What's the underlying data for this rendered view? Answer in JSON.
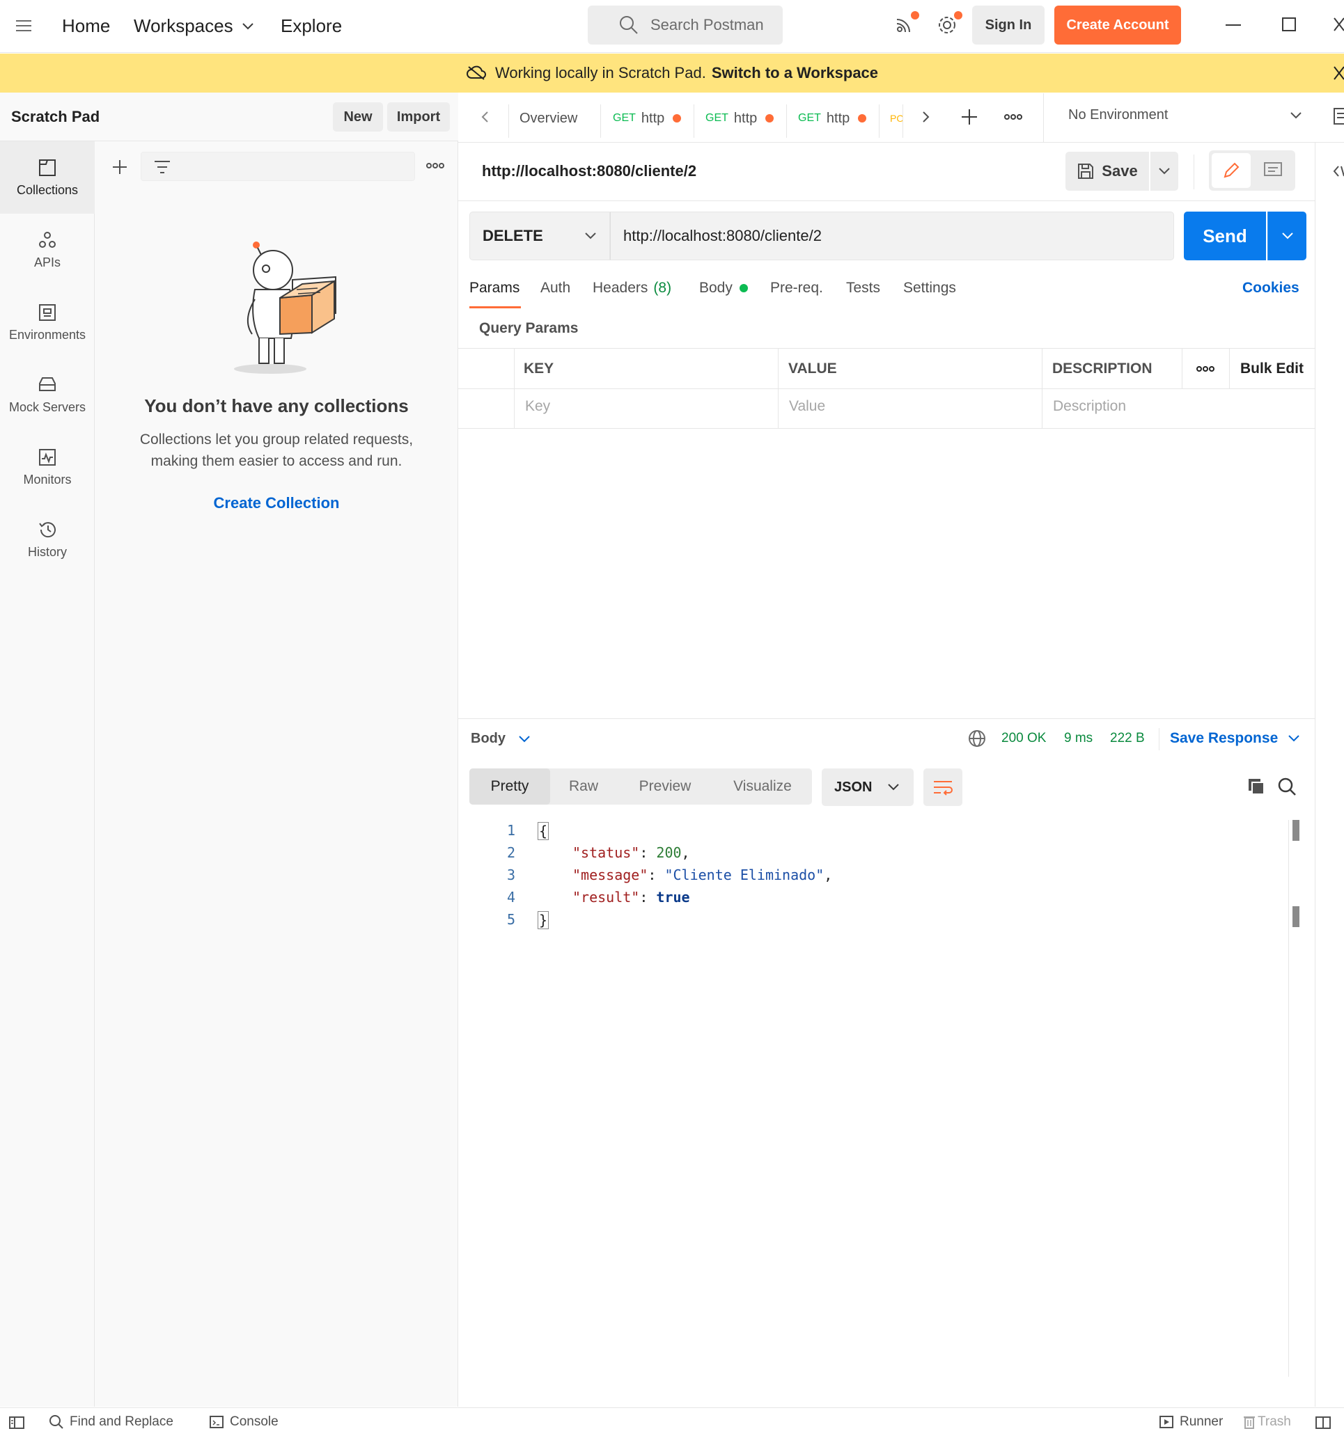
{
  "topbar": {
    "nav": [
      {
        "label": "Home"
      },
      {
        "label": "Workspaces"
      },
      {
        "label": "Explore"
      }
    ],
    "search_placeholder": "Search Postman",
    "sign_in": "Sign In",
    "create_account": "Create Account"
  },
  "banner": {
    "text": "Working locally in Scratch Pad.",
    "link": "Switch to a Workspace"
  },
  "rail": {
    "items": [
      {
        "label": "Collections",
        "icon": "collections-icon"
      },
      {
        "label": "APIs",
        "icon": "apis-icon"
      },
      {
        "label": "Environments",
        "icon": "environments-icon"
      },
      {
        "label": "Mock Servers",
        "icon": "mock-servers-icon"
      },
      {
        "label": "Monitors",
        "icon": "monitors-icon"
      },
      {
        "label": "History",
        "icon": "history-icon"
      }
    ]
  },
  "sidebar": {
    "title": "Scratch Pad",
    "new_label": "New",
    "import_label": "Import",
    "empty_title": "You don’t have any collections",
    "empty_desc": "Collections let you group related requests, making them easier to access and run.",
    "create_collection": "Create Collection"
  },
  "tabs": {
    "overview": "Overview",
    "items": [
      {
        "method": "GET",
        "label": "http"
      },
      {
        "method": "GET",
        "label": "http"
      },
      {
        "method": "GET",
        "label": "http"
      }
    ],
    "partial": "PO",
    "environment": "No Environment"
  },
  "request": {
    "title": "http://localhost:8080/cliente/2",
    "save_label": "Save",
    "method": "DELETE",
    "url": "http://localhost:8080/cliente/2",
    "send_label": "Send",
    "tabs": {
      "params": "Params",
      "auth": "Auth",
      "headers": "Headers",
      "headers_count": "(8)",
      "body": "Body",
      "prereq": "Pre-req.",
      "tests": "Tests",
      "settings": "Settings"
    },
    "cookies": "Cookies",
    "query_params_title": "Query Params",
    "table": {
      "headers": [
        "KEY",
        "VALUE",
        "DESCRIPTION"
      ],
      "bulk_edit": "Bulk Edit",
      "placeholders": [
        "Key",
        "Value",
        "Description"
      ]
    }
  },
  "response": {
    "body_label": "Body",
    "status": "200 OK",
    "time": "9 ms",
    "size": "222 B",
    "save_response": "Save Response",
    "view_tabs": [
      "Pretty",
      "Raw",
      "Preview",
      "Visualize"
    ],
    "format": "JSON",
    "line_numbers": [
      "1",
      "2",
      "3",
      "4",
      "5"
    ],
    "json": {
      "open": "{",
      "close": "}",
      "lines": [
        {
          "key": "\"status\"",
          "value": "200",
          "type": "number",
          "comma": ","
        },
        {
          "key": "\"message\"",
          "value": "\"Cliente Eliminado\"",
          "type": "string",
          "comma": ","
        },
        {
          "key": "\"result\"",
          "value": "true",
          "type": "bool",
          "comma": ""
        }
      ]
    }
  },
  "statusbar": {
    "find_replace": "Find and Replace",
    "console": "Console",
    "runner": "Runner",
    "trash": "Trash"
  },
  "colors": {
    "accent_orange": "#ff6c37",
    "send_blue": "#097bed",
    "link_blue": "#0265d2",
    "banner_yellow": "#ffe47e",
    "status_green": "#0a8a3e"
  }
}
